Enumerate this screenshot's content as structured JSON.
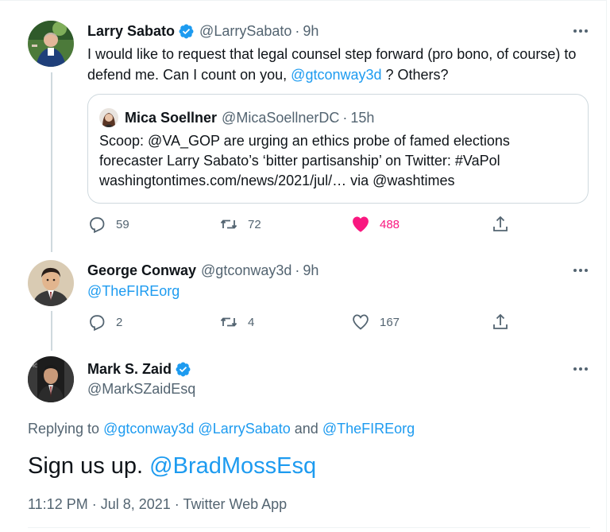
{
  "colors": {
    "accent": "#1d9bf0",
    "like": "#f91880",
    "muted": "#536471",
    "text": "#0f1419"
  },
  "tweet1": {
    "name": "Larry Sabato",
    "handle": "@LarrySabato",
    "dot": "·",
    "time": "9h",
    "text_before": "I would like to request that legal counsel step forward (pro bono, of course) to defend me. Can I count on you, ",
    "mention": "@gtconway3d",
    "text_after": " ? Others?",
    "quote": {
      "name": "Mica Soellner",
      "handle": "@MicaSoellnerDC",
      "time": "15h",
      "line1": "Scoop: @VA_GOP are urging an ethics probe of famed elections",
      "line2": "forecaster Larry Sabato’s ‘bitter partisanship’ on Twitter: #VaPol",
      "line3": "washingtontimes.com/news/2021/jul/… via @washtimes"
    },
    "replies": "59",
    "retweets": "72",
    "likes": "488",
    "icons": [
      "verified-icon",
      "reply-icon",
      "retweet-icon",
      "heart-filled-icon",
      "share-icon",
      "more-icon"
    ]
  },
  "tweet2": {
    "name": "George Conway",
    "handle": "@gtconway3d",
    "dot": "·",
    "time": "9h",
    "text": "@TheFIREorg",
    "replies": "2",
    "retweets": "4",
    "likes": "167"
  },
  "tweet3": {
    "name": "Mark S. Zaid",
    "handle": "@MarkSZaidEsq",
    "replying_label": "Replying to ",
    "replying_1": "@gtconway3d",
    "replying_2": "@LarrySabato",
    "replying_and": " and ",
    "replying_3": "@TheFIREorg",
    "body": "Sign us up. ",
    "body_mention": "@BradMossEsq",
    "timestamp": "11:12 PM · Jul 8, 2021 · Twitter Web App"
  }
}
